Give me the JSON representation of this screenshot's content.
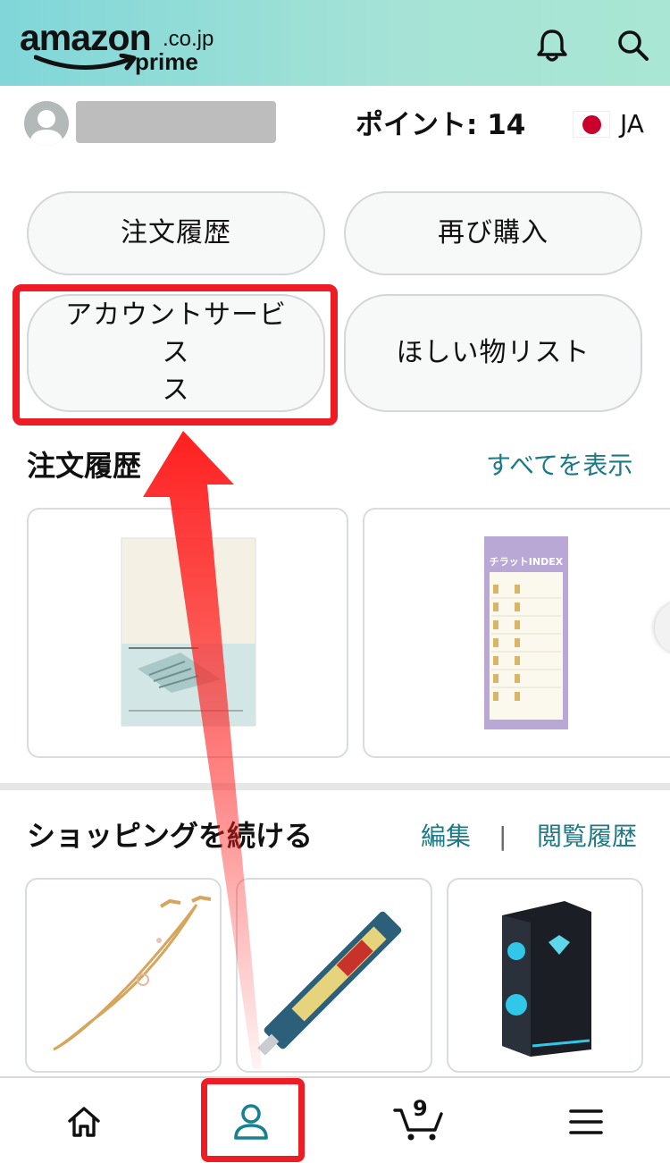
{
  "header": {
    "logo_word": "amazon",
    "logo_tld": ".co.jp",
    "logo_sub": "prime",
    "icons": [
      "bell-icon",
      "search-icon"
    ]
  },
  "user": {
    "points_text": "ポイント: 14",
    "language": "JA",
    "flag": "japan-flag"
  },
  "quick_buttons": {
    "order_history": "注文履歴",
    "buy_again": "再び購入",
    "account_services": "アカウントサービス",
    "account_services_wrap": "ス",
    "wish_list": "ほしい物リスト"
  },
  "orders_section": {
    "title": "注文履歴",
    "view_all": "すべてを表示",
    "items": [
      "notebook-product-image",
      "index-tab-sticky-notes-product-image"
    ],
    "item2_label": "チラットINDEX"
  },
  "continue_shopping": {
    "title": "ショッピングを続ける",
    "edit_link": "編集",
    "separator": "|",
    "history_link": "閲覧履歴",
    "items": [
      "glasses-chain-product-image",
      "utility-knife-product-image",
      "gaming-pc-product-image"
    ]
  },
  "bottom_nav": {
    "items": [
      "home-icon",
      "account-icon",
      "cart-icon",
      "menu-icon"
    ],
    "cart_count": "9"
  },
  "colors": {
    "header_gradient_start": "#80d6d8",
    "header_gradient_end": "#a9e6d3",
    "link": "#1a7a86",
    "account_icon": "#168290",
    "highlight_red": "#ee1c25"
  }
}
